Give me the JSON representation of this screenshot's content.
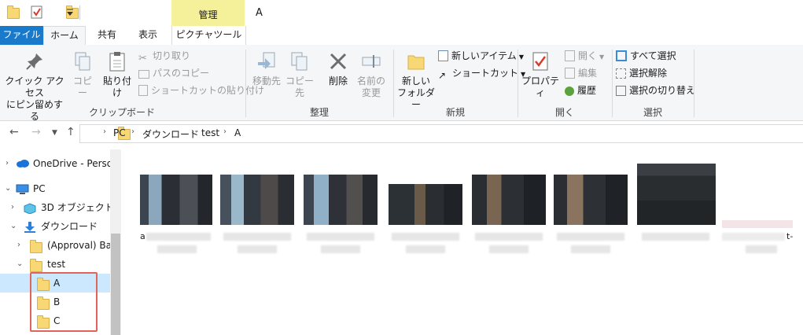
{
  "window": {
    "title": "A",
    "context_group": "管理"
  },
  "tabs": {
    "file": "ファイル",
    "home": "ホーム",
    "share": "共有",
    "view": "表示",
    "picture_tools": "ピクチャツール"
  },
  "ribbon": {
    "clipboard": {
      "pin": "クイック アクセス\nにピン留めする",
      "copy": "コピー",
      "paste": "貼り付け",
      "cut": "切り取り",
      "copy_path": "パスのコピー",
      "paste_shortcut": "ショートカットの貼り付け",
      "label": "クリップボード"
    },
    "organize": {
      "move_to": "移動先",
      "copy_to": "コピー先",
      "delete": "削除",
      "rename": "名前の\n変更",
      "label": "整理"
    },
    "new": {
      "new_folder": "新しい\nフォルダー",
      "new_item": "新しいアイテム",
      "shortcut": "ショートカット",
      "label": "新規"
    },
    "open": {
      "properties": "プロパティ",
      "open": "開く",
      "edit": "編集",
      "history": "履歴",
      "label": "開く"
    },
    "select": {
      "select_all": "すべて選択",
      "select_none": "選択解除",
      "invert": "選択の切り替え",
      "label": "選択"
    }
  },
  "address": {
    "crumbs": [
      "PC",
      "ダウンロード",
      "test",
      "A"
    ]
  },
  "nav": {
    "onedrive": "OneDrive - Person",
    "pc": "PC",
    "objects3d": "3D オブジェクト",
    "downloads": "ダウンロード",
    "approval": "(Approval) Barı",
    "test": "test",
    "a": "A",
    "b": "B",
    "c": "C"
  },
  "content": {
    "cap_first": "a",
    "cap_last": "t-"
  },
  "colors": {
    "accent": "#1979ca",
    "selection": "#cce8ff",
    "highlight": "#e0645a",
    "context": "#f5f09a"
  }
}
